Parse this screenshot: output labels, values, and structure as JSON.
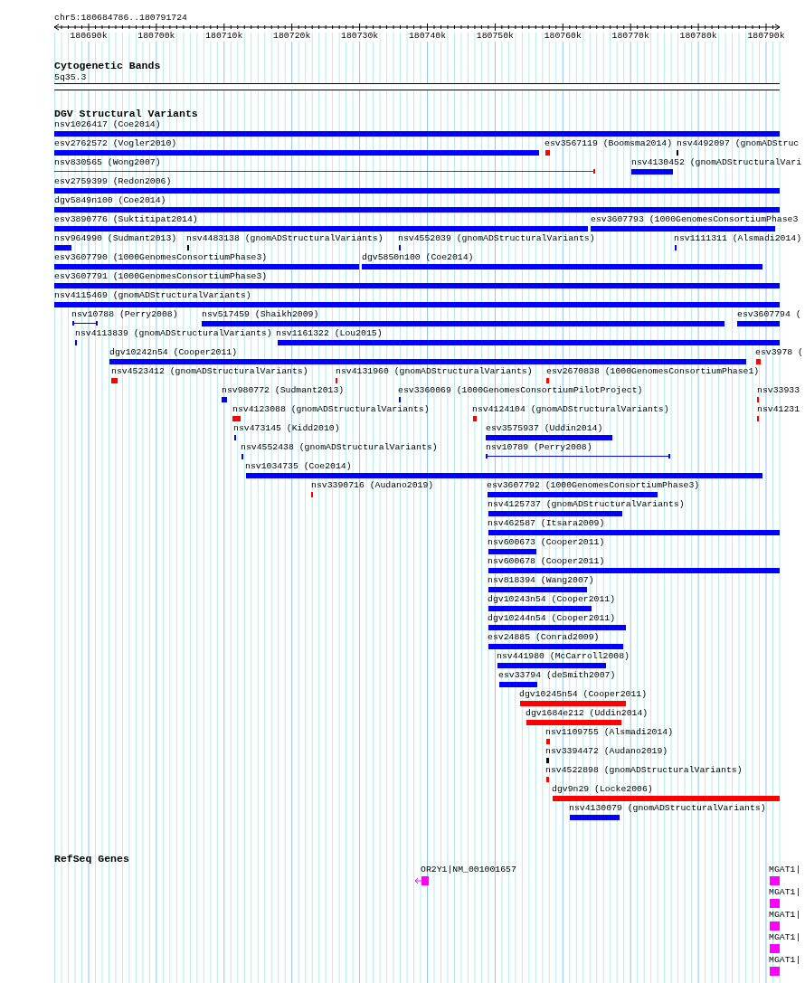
{
  "ruler": {
    "position": "chr5:180684786..180791724",
    "ticks": [
      "180690k",
      "180700k",
      "180710k",
      "180720k",
      "180730k",
      "180740k",
      "180750k",
      "180760k",
      "180770k",
      "180780k",
      "180790k"
    ]
  },
  "tracks": [
    {
      "title": "Cytogenetic Bands",
      "kind": "bands",
      "features": [
        {
          "label": "5q35.3"
        }
      ]
    },
    {
      "title": "DGV Structural Variants",
      "kind": "variants",
      "features": [
        {
          "label": "nsv1026417 (Coe2014)",
          "color": "#0000ff",
          "kind": "block"
        },
        {
          "label": "esv2762572 (Vogler2010)",
          "color": "#0000ff",
          "kind": "block"
        },
        {
          "label": "esv3567119 (Boomsma2014)",
          "color": "#ff0000",
          "kind": "block"
        },
        {
          "label": "nsv4492097 (gnomADStruc",
          "color": "#000000",
          "kind": "block"
        },
        {
          "label": "nsv830565 (Wong2007)",
          "color": "#ff0000",
          "kind": "span-open-left"
        },
        {
          "label": "nsv4130452 (gnomADStructuralVari",
          "color": "#0000ff",
          "kind": "block"
        },
        {
          "label": "esv2759399 (Redon2006)",
          "color": "#0000ff",
          "kind": "block"
        },
        {
          "label": "dgv5849n100 (Coe2014)",
          "color": "#0000ff",
          "kind": "block"
        },
        {
          "label": "esv3890776 (Suktitipat2014)",
          "color": "#0000ff",
          "kind": "block"
        },
        {
          "label": "esv3607793 (1000GenomesConsortiumPhase3",
          "color": "#0000ff",
          "kind": "block"
        },
        {
          "label": "nsv964990 (Sudmant2013)",
          "color": "#0000ff",
          "kind": "block"
        },
        {
          "label": "nsv4483138 (gnomADStructuralVariants)",
          "color": "#000000",
          "kind": "block"
        },
        {
          "label": "nsv4552039 (gnomADStructuralVariants)",
          "color": "#0000ff",
          "kind": "block"
        },
        {
          "label": "nsv1111311 (Alsmadi2014)",
          "color": "#0000ff",
          "kind": "block"
        },
        {
          "label": "esv3607790 (1000GenomesConsortiumPhase3)",
          "color": "#0000ff",
          "kind": "block"
        },
        {
          "label": "dgv5850n100 (Coe2014)",
          "color": "#0000ff",
          "kind": "block"
        },
        {
          "label": "esv3607791 (1000GenomesConsortiumPhase3)",
          "color": "#0000ff",
          "kind": "block"
        },
        {
          "label": "nsv4115469 (gnomADStructuralVariants)",
          "color": "#0000ff",
          "kind": "block"
        },
        {
          "label": "nsv10788 (Perry2008)",
          "color": "#0000ff",
          "kind": "span"
        },
        {
          "label": "nsv517459 (Shaikh2009)",
          "color": "#0000ff",
          "kind": "block"
        },
        {
          "label": "esv3607794 (",
          "color": "#0000ff",
          "kind": "block"
        },
        {
          "label": "nsv4113839 (gnomADStructuralVariants)",
          "color": "#0000ff",
          "kind": "block"
        },
        {
          "label": "nsv1161322 (Lou2015)",
          "color": "#0000ff",
          "kind": "block"
        },
        {
          "label": "dgv10242n54 (Cooper2011)",
          "color": "#0000ff",
          "kind": "block"
        },
        {
          "label": "esv3978 (",
          "color": "#ff0000",
          "kind": "block"
        },
        {
          "label": "nsv4523412 (gnomADStructuralVariants)",
          "color": "#ff0000",
          "kind": "block"
        },
        {
          "label": "nsv4131960 (gnomADStructuralVariants)",
          "color": "#ff0000",
          "kind": "block"
        },
        {
          "label": "esv2670838 (1000GenomesConsortiumPhase1)",
          "color": "#ff0000",
          "kind": "block"
        },
        {
          "label": "nsv980772 (Sudmant2013)",
          "color": "#0000ff",
          "kind": "block"
        },
        {
          "label": "esv3360069 (1000GenomesConsortiumPilotProject)",
          "color": "#0000ff",
          "kind": "block"
        },
        {
          "label": "nsv33933",
          "color": "#ff0000",
          "kind": "block"
        },
        {
          "label": "nsv4123088 (gnomADStructuralVariants)",
          "color": "#ff0000",
          "kind": "block"
        },
        {
          "label": "nsv4124104 (gnomADStructuralVariants)",
          "color": "#ff0000",
          "kind": "block"
        },
        {
          "label": "nsv41231",
          "color": "#ff0000",
          "kind": "block"
        },
        {
          "label": "nsv473145 (Kidd2010)",
          "color": "#0000ff",
          "kind": "block"
        },
        {
          "label": "esv3575937 (Uddin2014)",
          "color": "#0000ff",
          "kind": "block"
        },
        {
          "label": "nsv4552438 (gnomADStructuralVariants)",
          "color": "#0000ff",
          "kind": "block"
        },
        {
          "label": "nsv10789 (Perry2008)",
          "color": "#0000ff",
          "kind": "span"
        },
        {
          "label": "nsv1034735 (Coe2014)",
          "color": "#0000ff",
          "kind": "block"
        },
        {
          "label": "nsv3390716 (Audano2019)",
          "color": "#ff0000",
          "kind": "block"
        },
        {
          "label": "esv3607792 (1000GenomesConsortiumPhase3)",
          "color": "#0000ff",
          "kind": "block"
        },
        {
          "label": "nsv4125737 (gnomADStructuralVariants)",
          "color": "#0000ff",
          "kind": "block"
        },
        {
          "label": "nsv462587 (Itsara2009)",
          "color": "#0000ff",
          "kind": "block"
        },
        {
          "label": "nsv600673 (Cooper2011)",
          "color": "#0000ff",
          "kind": "block"
        },
        {
          "label": "nsv600678 (Cooper2011)",
          "color": "#0000ff",
          "kind": "block"
        },
        {
          "label": "nsv818394 (Wang2007)",
          "color": "#0000ff",
          "kind": "block"
        },
        {
          "label": "dgv10243n54 (Cooper2011)",
          "color": "#0000ff",
          "kind": "block"
        },
        {
          "label": "dgv10244n54 (Cooper2011)",
          "color": "#0000ff",
          "kind": "block"
        },
        {
          "label": "esv24885 (Conrad2009)",
          "color": "#0000ff",
          "kind": "block"
        },
        {
          "label": "nsv441980 (McCarroll2008)",
          "color": "#0000ff",
          "kind": "block"
        },
        {
          "label": "esv33794 (deSmith2007)",
          "color": "#0000ff",
          "kind": "block"
        },
        {
          "label": "dgv10245n54 (Cooper2011)",
          "color": "#ff0000",
          "kind": "block"
        },
        {
          "label": "dgv1684e212 (Uddin2014)",
          "color": "#ff0000",
          "kind": "block"
        },
        {
          "label": "nsv1109755 (Alsmadi2014)",
          "color": "#ff0000",
          "kind": "block"
        },
        {
          "label": "nsv3394472 (Audano2019)",
          "color": "#000000",
          "kind": "block"
        },
        {
          "label": "nsv4522898 (gnomADStructuralVariants)",
          "color": "#ff0000",
          "kind": "block"
        },
        {
          "label": "dgv9n29 (Locke2006)",
          "color": "#ff0000",
          "kind": "block"
        },
        {
          "label": "nsv4130079 (gnomADStructuralVariants)",
          "color": "#0000ff",
          "kind": "block"
        }
      ]
    },
    {
      "title": "RefSeq Genes",
      "kind": "genes",
      "features": [
        {
          "label": "OR2Y1|NM_001001657",
          "kind": "reverse"
        },
        {
          "label": "MGAT1|",
          "kind": "plain"
        },
        {
          "label": "MGAT1|",
          "kind": "plain"
        },
        {
          "label": "MGAT1|",
          "kind": "plain"
        },
        {
          "label": "MGAT1|",
          "kind": "plain"
        },
        {
          "label": "MGAT1|",
          "kind": "plain"
        }
      ]
    }
  ]
}
